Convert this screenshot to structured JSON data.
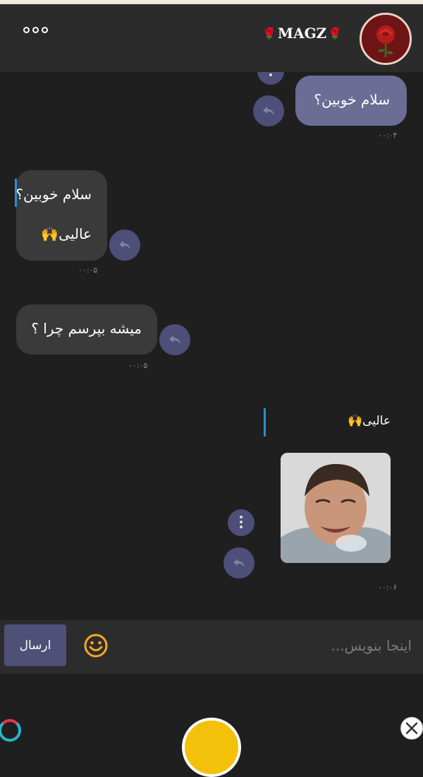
{
  "header": {
    "title": "MAGZ",
    "title_left_emoji": "🌹",
    "title_right_emoji": "🌹",
    "menu_icon": "more-horizontal-icon",
    "avatar_icon": "rose-avatar"
  },
  "messages": [
    {
      "direction": "outgoing",
      "text": "سلام خوبین؟",
      "time": "۰۰:۰۴"
    },
    {
      "direction": "incoming",
      "quote": "سلام خوبین؟",
      "text": "عالیی🙌",
      "time": "۰۰:۰۵"
    },
    {
      "direction": "incoming",
      "text": "میشه بپرسم چرا ؟",
      "time": "۰۰:۰۵"
    },
    {
      "direction": "outgoing",
      "quote": "عالیی🙌",
      "image": "photo-of-laughing-man",
      "time": "۰۰:۰۶"
    }
  ],
  "composer": {
    "placeholder": "اینجا بنویس...",
    "send_label": "ارسال",
    "emoji_icon": "smiley-icon"
  },
  "colors": {
    "background": "#1f1f1f",
    "header": "#2b2b2b",
    "outgoing_bubble": "#6b6d94",
    "incoming_bubble": "#3a3a3a",
    "reply_button": "#4d4f78",
    "quote_bar": "#2a8fd0",
    "emoji_accent": "#f6a623",
    "fab": "#f4c10a"
  }
}
